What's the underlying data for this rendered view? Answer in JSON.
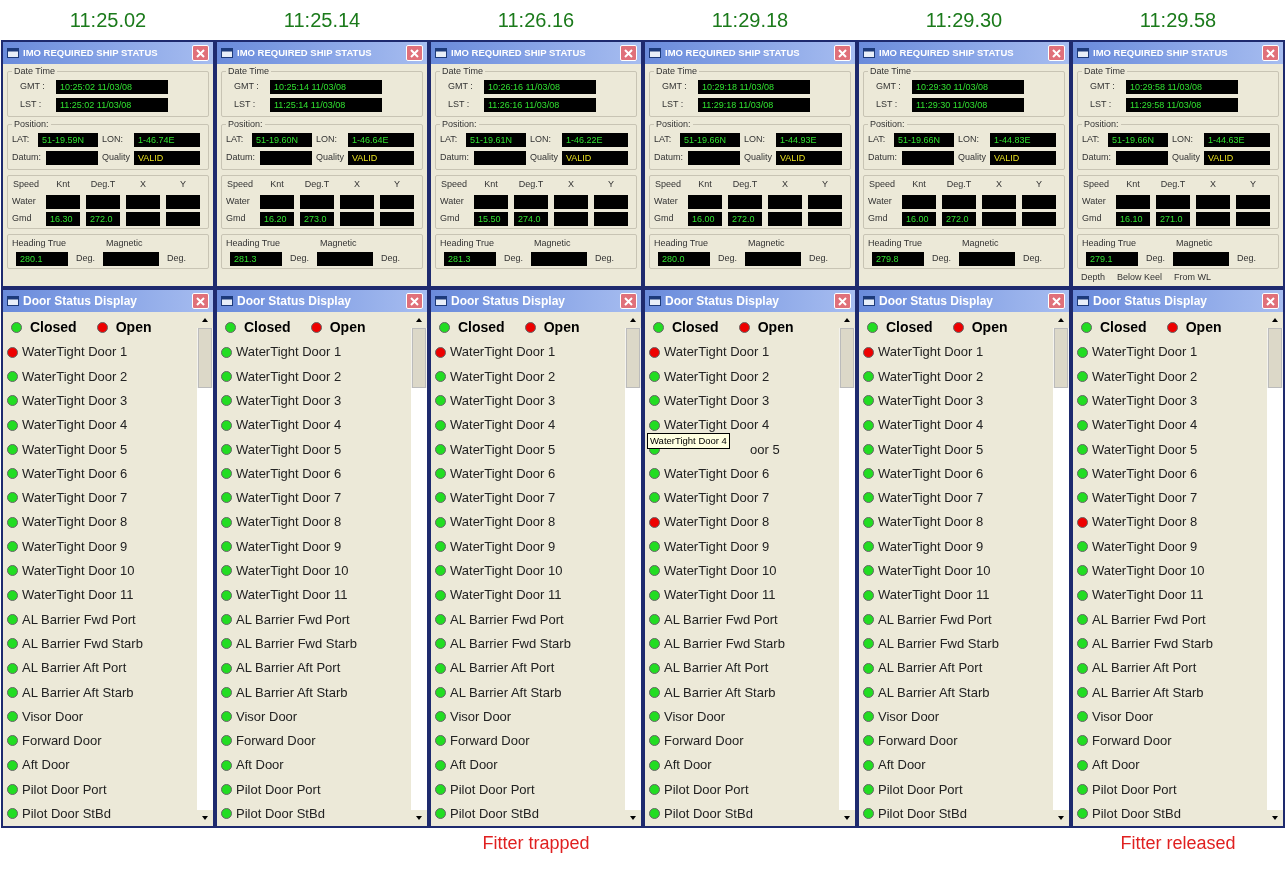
{
  "panels": [
    {
      "timestamp": "11:25.02",
      "status": {
        "title": "IMO REQUIRED SHIP STATUS",
        "date_label": "Date Time",
        "gmt_label": "GMT :",
        "gmt": "10:25:02 11/03/08",
        "lst_label": "LST :",
        "lst": "11:25:02 11/03/08",
        "pos_label": "Position:",
        "lat_label": "LAT:",
        "lat": "51-19.59N",
        "lon_label": "LON:",
        "lon": "1-46.74E",
        "datum_label": "Datum:",
        "quality_label": "Quality",
        "quality": "VALID",
        "speed_headers": [
          "Speed",
          "Knt",
          "Deg.T",
          "X",
          "Y"
        ],
        "water_label": "Water",
        "gmd_label": "Gmd",
        "gmd_knt": "16.30",
        "gmd_deg": "272.0",
        "heading_label": "Heading True",
        "heading": "280.1",
        "heading_unit": "Deg.",
        "magnetic_label": "Magnetic",
        "magnetic_unit": "Deg."
      },
      "doors": {
        "title": "Door Status Display",
        "legend": [
          {
            "label": "Closed",
            "open": false
          },
          {
            "label": "Open",
            "open": true
          }
        ],
        "items": [
          {
            "name": "WaterTight Door 1",
            "open": true
          },
          {
            "name": "WaterTight Door 2",
            "open": false
          },
          {
            "name": "WaterTight Door 3",
            "open": false
          },
          {
            "name": "WaterTight Door 4",
            "open": false
          },
          {
            "name": "WaterTight Door 5",
            "open": false
          },
          {
            "name": "WaterTight Door 6",
            "open": false
          },
          {
            "name": "WaterTight Door 7",
            "open": false
          },
          {
            "name": "WaterTight Door 8",
            "open": false
          },
          {
            "name": "WaterTight Door 9",
            "open": false
          },
          {
            "name": "WaterTight Door 10",
            "open": false
          },
          {
            "name": "WaterTight Door 11",
            "open": false
          },
          {
            "name": "AL Barrier Fwd Port",
            "open": false
          },
          {
            "name": "AL Barrier Fwd Starb",
            "open": false
          },
          {
            "name": "AL Barrier Aft Port",
            "open": false
          },
          {
            "name": "AL Barrier Aft Starb",
            "open": false
          },
          {
            "name": "Visor Door",
            "open": false
          },
          {
            "name": "Forward Door",
            "open": false
          },
          {
            "name": "Aft Door",
            "open": false
          },
          {
            "name": "Pilot Door Port",
            "open": false
          },
          {
            "name": "Pilot Door StBd",
            "open": false
          }
        ]
      }
    },
    {
      "timestamp": "11:25.14",
      "status": {
        "title": "IMO REQUIRED SHIP STATUS",
        "date_label": "Date Time",
        "gmt_label": "GMT :",
        "gmt": "10:25:14 11/03/08",
        "lst_label": "LST :",
        "lst": "11:25:14 11/03/08",
        "pos_label": "Position:",
        "lat_label": "LAT:",
        "lat": "51-19.60N",
        "lon_label": "LON:",
        "lon": "1-46.64E",
        "datum_label": "Datum:",
        "quality_label": "Quality",
        "quality": "VALID",
        "speed_headers": [
          "Speed",
          "Knt",
          "Deg.T",
          "X",
          "Y"
        ],
        "water_label": "Water",
        "gmd_label": "Gmd",
        "gmd_knt": "16.20",
        "gmd_deg": "273.0",
        "heading_label": "Heading True",
        "heading": "281.3",
        "heading_unit": "Deg.",
        "magnetic_label": "Magnetic",
        "magnetic_unit": "Deg."
      },
      "doors": {
        "title": "Door Status Display",
        "legend": [
          {
            "label": "Closed",
            "open": false
          },
          {
            "label": "Open",
            "open": true
          }
        ],
        "items": [
          {
            "name": "WaterTight Door 1",
            "open": false
          },
          {
            "name": "WaterTight Door 2",
            "open": false
          },
          {
            "name": "WaterTight Door 3",
            "open": false
          },
          {
            "name": "WaterTight Door 4",
            "open": false
          },
          {
            "name": "WaterTight Door 5",
            "open": false
          },
          {
            "name": "WaterTight Door 6",
            "open": false
          },
          {
            "name": "WaterTight Door 7",
            "open": false
          },
          {
            "name": "WaterTight Door 8",
            "open": false
          },
          {
            "name": "WaterTight Door 9",
            "open": false
          },
          {
            "name": "WaterTight Door 10",
            "open": false
          },
          {
            "name": "WaterTight Door 11",
            "open": false
          },
          {
            "name": "AL Barrier Fwd Port",
            "open": false
          },
          {
            "name": "AL Barrier Fwd Starb",
            "open": false
          },
          {
            "name": "AL Barrier Aft Port",
            "open": false
          },
          {
            "name": "AL Barrier Aft Starb",
            "open": false
          },
          {
            "name": "Visor Door",
            "open": false
          },
          {
            "name": "Forward Door",
            "open": false
          },
          {
            "name": "Aft Door",
            "open": false
          },
          {
            "name": "Pilot Door Port",
            "open": false
          },
          {
            "name": "Pilot Door StBd",
            "open": false
          }
        ]
      }
    },
    {
      "timestamp": "11:26.16",
      "status": {
        "title": "IMO REQUIRED SHIP STATUS",
        "date_label": "Date Time",
        "gmt_label": "GMT :",
        "gmt": "10:26:16 11/03/08",
        "lst_label": "LST :",
        "lst": "11:26:16 11/03/08",
        "pos_label": "Position:",
        "lat_label": "LAT:",
        "lat": "51-19.61N",
        "lon_label": "LON:",
        "lon": "1-46.22E",
        "datum_label": "Datum:",
        "quality_label": "Quality",
        "quality": "VALID",
        "speed_headers": [
          "Speed",
          "Knt",
          "Deg.T",
          "X",
          "Y"
        ],
        "water_label": "Water",
        "gmd_label": "Gmd",
        "gmd_knt": "15.50",
        "gmd_deg": "274.0",
        "heading_label": "Heading True",
        "heading": "281.3",
        "heading_unit": "Deg.",
        "magnetic_label": "Magnetic",
        "magnetic_unit": "Deg."
      },
      "doors": {
        "title": "Door Status Display",
        "legend": [
          {
            "label": "Closed",
            "open": false
          },
          {
            "label": "Open",
            "open": true
          }
        ],
        "items": [
          {
            "name": "WaterTight Door 1",
            "open": true
          },
          {
            "name": "WaterTight Door 2",
            "open": false
          },
          {
            "name": "WaterTight Door 3",
            "open": false
          },
          {
            "name": "WaterTight Door 4",
            "open": false
          },
          {
            "name": "WaterTight Door 5",
            "open": false
          },
          {
            "name": "WaterTight Door 6",
            "open": false
          },
          {
            "name": "WaterTight Door 7",
            "open": false
          },
          {
            "name": "WaterTight Door 8",
            "open": false
          },
          {
            "name": "WaterTight Door 9",
            "open": false
          },
          {
            "name": "WaterTight Door 10",
            "open": false
          },
          {
            "name": "WaterTight Door 11",
            "open": false
          },
          {
            "name": "AL Barrier Fwd Port",
            "open": false
          },
          {
            "name": "AL Barrier Fwd Starb",
            "open": false
          },
          {
            "name": "AL Barrier Aft Port",
            "open": false
          },
          {
            "name": "AL Barrier Aft Starb",
            "open": false
          },
          {
            "name": "Visor Door",
            "open": false
          },
          {
            "name": "Forward Door",
            "open": false
          },
          {
            "name": "Aft Door",
            "open": false
          },
          {
            "name": "Pilot Door Port",
            "open": false
          },
          {
            "name": "Pilot Door StBd",
            "open": false
          }
        ]
      },
      "caption": "Fitter trapped"
    },
    {
      "timestamp": "11:29.18",
      "status": {
        "title": "IMO REQUIRED SHIP STATUS",
        "date_label": "Date Time",
        "gmt_label": "GMT :",
        "gmt": "10:29:18 11/03/08",
        "lst_label": "LST :",
        "lst": "11:29:18 11/03/08",
        "pos_label": "Position:",
        "lat_label": "LAT:",
        "lat": "51-19.66N",
        "lon_label": "LON:",
        "lon": "1-44.93E",
        "datum_label": "Datum:",
        "quality_label": "Quality",
        "quality": "VALID",
        "speed_headers": [
          "Speed",
          "Knt",
          "Deg.T",
          "X",
          "Y"
        ],
        "water_label": "Water",
        "gmd_label": "Gmd",
        "gmd_knt": "16.00",
        "gmd_deg": "272.0",
        "heading_label": "Heading True",
        "heading": "280.0",
        "heading_unit": "Deg.",
        "magnetic_label": "Magnetic",
        "magnetic_unit": "Deg."
      },
      "doors": {
        "title": "Door Status Display",
        "legend": [
          {
            "label": "Closed",
            "open": false
          },
          {
            "label": "Open",
            "open": true
          }
        ],
        "items": [
          {
            "name": "WaterTight Door 1",
            "open": true
          },
          {
            "name": "WaterTight Door 2",
            "open": false
          },
          {
            "name": "WaterTight Door 3",
            "open": false
          },
          {
            "name": "WaterTight Door 4",
            "open": false,
            "tooltip": "WaterTight Door 4"
          },
          {
            "name": "oor 5",
            "open": false,
            "covered": true
          },
          {
            "name": "WaterTight Door 6",
            "open": false
          },
          {
            "name": "WaterTight Door 7",
            "open": false
          },
          {
            "name": "WaterTight Door 8",
            "open": true
          },
          {
            "name": "WaterTight Door 9",
            "open": false
          },
          {
            "name": "WaterTight Door 10",
            "open": false
          },
          {
            "name": "WaterTight Door 11",
            "open": false
          },
          {
            "name": "AL Barrier Fwd Port",
            "open": false
          },
          {
            "name": "AL Barrier Fwd Starb",
            "open": false
          },
          {
            "name": "AL Barrier Aft Port",
            "open": false
          },
          {
            "name": "AL Barrier Aft Starb",
            "open": false
          },
          {
            "name": "Visor Door",
            "open": false
          },
          {
            "name": "Forward Door",
            "open": false
          },
          {
            "name": "Aft Door",
            "open": false
          },
          {
            "name": "Pilot Door Port",
            "open": false
          },
          {
            "name": "Pilot Door StBd",
            "open": false
          }
        ]
      }
    },
    {
      "timestamp": "11:29.30",
      "status": {
        "title": "IMO REQUIRED SHIP STATUS",
        "date_label": "Date Time",
        "gmt_label": "GMT :",
        "gmt": "10:29:30 11/03/08",
        "lst_label": "LST :",
        "lst": "11:29:30 11/03/08",
        "pos_label": "Position:",
        "lat_label": "LAT:",
        "lat": "51-19.66N",
        "lon_label": "LON:",
        "lon": "1-44.83E",
        "datum_label": "Datum:",
        "quality_label": "Quality",
        "quality": "VALID",
        "speed_headers": [
          "Speed",
          "Knt",
          "Deg.T",
          "X",
          "Y"
        ],
        "water_label": "Water",
        "gmd_label": "Gmd",
        "gmd_knt": "16.00",
        "gmd_deg": "272.0",
        "heading_label": "Heading True",
        "heading": "279.8",
        "heading_unit": "Deg.",
        "magnetic_label": "Magnetic",
        "magnetic_unit": "Deg."
      },
      "doors": {
        "title": "Door Status Display",
        "legend": [
          {
            "label": "Closed",
            "open": false
          },
          {
            "label": "Open",
            "open": true
          }
        ],
        "items": [
          {
            "name": "WaterTight Door 1",
            "open": true
          },
          {
            "name": "WaterTight Door 2",
            "open": false
          },
          {
            "name": "WaterTight Door 3",
            "open": false
          },
          {
            "name": "WaterTight Door 4",
            "open": false
          },
          {
            "name": "WaterTight Door 5",
            "open": false
          },
          {
            "name": "WaterTight Door 6",
            "open": false
          },
          {
            "name": "WaterTight Door 7",
            "open": false
          },
          {
            "name": "WaterTight Door 8",
            "open": false
          },
          {
            "name": "WaterTight Door 9",
            "open": false
          },
          {
            "name": "WaterTight Door 10",
            "open": false
          },
          {
            "name": "WaterTight Door 11",
            "open": false
          },
          {
            "name": "AL Barrier Fwd Port",
            "open": false
          },
          {
            "name": "AL Barrier Fwd Starb",
            "open": false
          },
          {
            "name": "AL Barrier Aft Port",
            "open": false
          },
          {
            "name": "AL Barrier Aft Starb",
            "open": false
          },
          {
            "name": "Visor Door",
            "open": false
          },
          {
            "name": "Forward Door",
            "open": false
          },
          {
            "name": "Aft Door",
            "open": false
          },
          {
            "name": "Pilot Door Port",
            "open": false
          },
          {
            "name": "Pilot Door StBd",
            "open": false
          }
        ]
      }
    },
    {
      "timestamp": "11:29.58",
      "status": {
        "title": "IMO REQUIRED SHIP STATUS",
        "date_label": "Date Time",
        "gmt_label": "GMT :",
        "gmt": "10:29:58 11/03/08",
        "lst_label": "LST :",
        "lst": "11:29:58 11/03/08",
        "pos_label": "Position:",
        "lat_label": "LAT:",
        "lat": "51-19.66N",
        "lon_label": "LON:",
        "lon": "1-44.63E",
        "datum_label": "Datum:",
        "quality_label": "Quality",
        "quality": "VALID",
        "speed_headers": [
          "Speed",
          "Knt",
          "Deg.T",
          "X",
          "Y"
        ],
        "water_label": "Water",
        "gmd_label": "Gmd",
        "gmd_knt": "16.10",
        "gmd_deg": "271.0",
        "heading_label": "Heading True",
        "heading": "279.1",
        "heading_unit": "Deg.",
        "magnetic_label": "Magnetic",
        "magnetic_unit": "Deg.",
        "depth_labels": [
          "Depth",
          "Below Keel",
          "From WL"
        ]
      },
      "doors": {
        "title": "Door Status Display",
        "legend": [
          {
            "label": "Closed",
            "open": false
          },
          {
            "label": "Open",
            "open": true
          }
        ],
        "items": [
          {
            "name": "WaterTight Door 1",
            "open": false
          },
          {
            "name": "WaterTight Door 2",
            "open": false
          },
          {
            "name": "WaterTight Door 3",
            "open": false
          },
          {
            "name": "WaterTight Door 4",
            "open": false
          },
          {
            "name": "WaterTight Door 5",
            "open": false
          },
          {
            "name": "WaterTight Door 6",
            "open": false
          },
          {
            "name": "WaterTight Door 7",
            "open": false
          },
          {
            "name": "WaterTight Door 8",
            "open": true
          },
          {
            "name": "WaterTight Door 9",
            "open": false
          },
          {
            "name": "WaterTight Door 10",
            "open": false
          },
          {
            "name": "WaterTight Door 11",
            "open": false
          },
          {
            "name": "AL Barrier Fwd Port",
            "open": false
          },
          {
            "name": "AL Barrier Fwd Starb",
            "open": false
          },
          {
            "name": "AL Barrier Aft Port",
            "open": false
          },
          {
            "name": "AL Barrier Aft Starb",
            "open": false
          },
          {
            "name": "Visor Door",
            "open": false
          },
          {
            "name": "Forward Door",
            "open": false
          },
          {
            "name": "Aft Door",
            "open": false
          },
          {
            "name": "Pilot Door Port",
            "open": false
          },
          {
            "name": "Pilot Door StBd",
            "open": false
          }
        ]
      },
      "caption": "Fitter released"
    }
  ]
}
